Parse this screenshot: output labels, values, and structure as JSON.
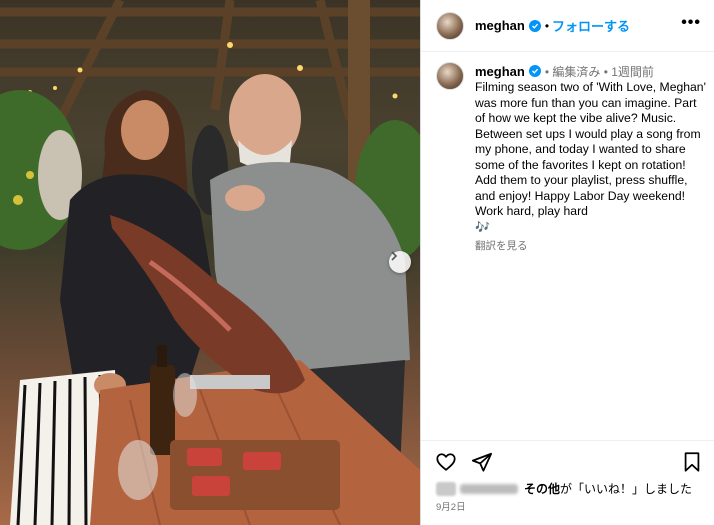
{
  "post": {
    "username": "meghan",
    "follow_label": "フォローする",
    "separator": "•",
    "more_label": "•••"
  },
  "caption": {
    "username": "meghan",
    "meta": "• 編集済み • 1週間前",
    "text": "Filming season two of 'With Love, Meghan' was more fun than you can imagine. Part of how we kept the vibe alive? Music. Between set ups I would play a song from my phone, and today I wanted to share some of the favorites I kept on rotation! Add them to your playlist, press shuffle, and enjoy! Happy Labor Day weekend! Work hard, play hard",
    "emoji": "🎶",
    "translate_label": "翻訳を見る"
  },
  "likes": {
    "others_text": "その他が「いいね！」しました",
    "others_bold": "その他"
  },
  "date": "9月2日",
  "icons": [
    "verified-icon",
    "heart-icon",
    "share-icon",
    "bookmark-icon",
    "chevron-right-icon",
    "more-icon"
  ]
}
